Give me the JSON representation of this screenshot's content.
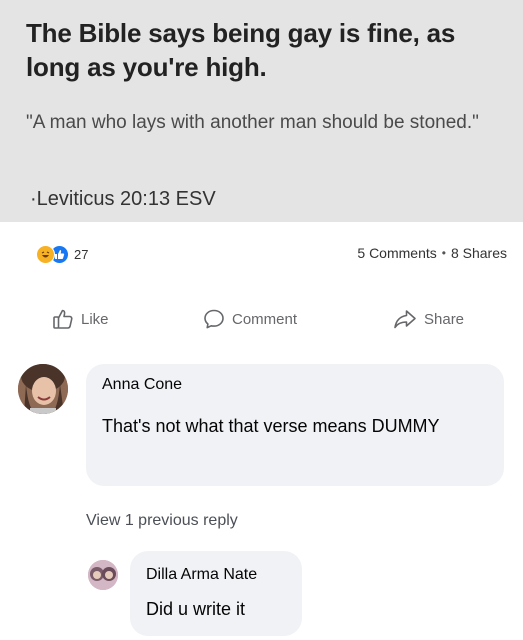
{
  "post": {
    "headline": "The Bible says being gay is fine, as long as you're high.",
    "quote": "\"A man who lays with another man should be stoned.\"",
    "citation": "·Leviticus 20:13 ESV"
  },
  "stats": {
    "reaction_count": "27",
    "comments": "5 Comments",
    "shares": "8 Shares",
    "separator": "•"
  },
  "actions": {
    "like": "Like",
    "comment": "Comment",
    "share": "Share"
  },
  "comments": [
    {
      "author": "Anna Cone",
      "text": "That's not what that verse means DUMMY"
    }
  ],
  "view_replies": "View 1 previous reply",
  "replies": [
    {
      "author": "Dilla Arma Nate",
      "text": "Did u write it"
    }
  ],
  "colors": {
    "like_blue": "#1877f2",
    "haha_yellow": "#f7b125",
    "bubble_gray": "#f0f2f5",
    "card_gray": "#e4e4e4"
  },
  "icons": [
    "haha-reaction-icon",
    "like-reaction-icon",
    "thumbs-up-icon",
    "comment-icon",
    "share-icon"
  ]
}
